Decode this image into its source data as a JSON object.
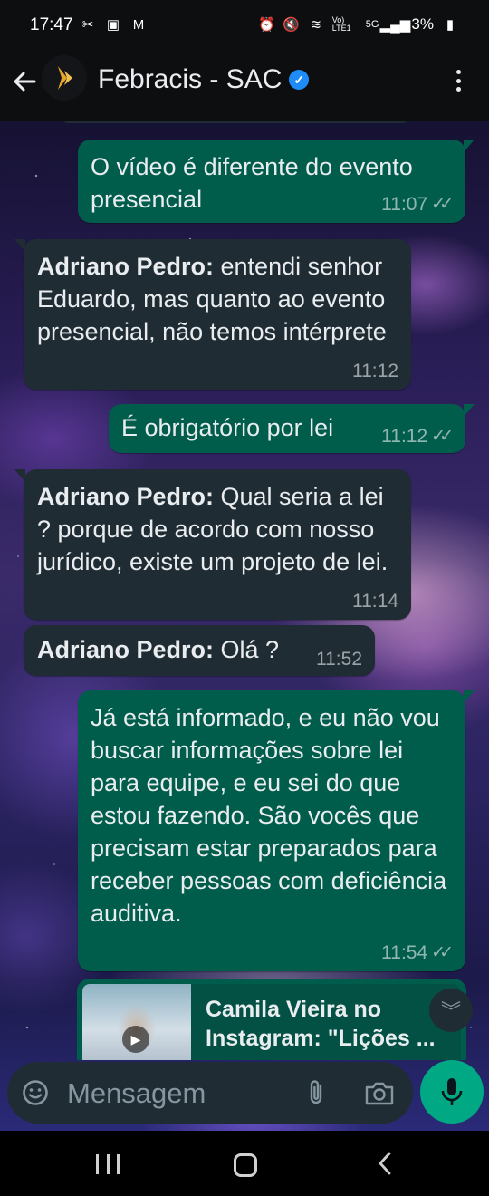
{
  "status_bar": {
    "time": "17:47",
    "battery": "3%",
    "network": "5G",
    "volte": "Vo) LTE1"
  },
  "header": {
    "title": "Febracis - SAC",
    "verified_icon": "verified-badge-icon",
    "accent_color": "#1d8cf8"
  },
  "messages": [
    {
      "direction": "out",
      "text": "O vídeo é diferente do evento presencial",
      "time": "11:07",
      "status": "read-ticks"
    },
    {
      "direction": "in",
      "sender": "Adriano Pedro:",
      "text": " entendi senhor Eduardo, mas quanto ao evento presencial, não temos intérprete",
      "time": "11:12"
    },
    {
      "direction": "out",
      "text": "É obrigatório por lei",
      "time": "11:12",
      "status": "read-ticks"
    },
    {
      "direction": "in",
      "sender": "Adriano Pedro:",
      "text": " Qual seria a lei ? porque de acordo com nosso jurídico, existe um projeto de lei.",
      "time": "11:14"
    },
    {
      "direction": "in",
      "sender": "Adriano Pedro:",
      "text": " Olá ?",
      "time": "11:52"
    },
    {
      "direction": "out",
      "text": "Já está informado, e eu não vou buscar informações sobre lei para equipe, e eu sei do que estou fazendo. São vocês que precisam estar preparados para receber pessoas com deficiência auditiva.",
      "time": "11:54",
      "status": "read-ticks"
    }
  ],
  "link_preview": {
    "title": "Camila Vieira no Instagram: \"Lições ..."
  },
  "input": {
    "placeholder": "Mensagem"
  },
  "colors": {
    "outgoing_bubble": "#005c4b",
    "incoming_bubble": "#202c33",
    "mic_button": "#00a884"
  }
}
